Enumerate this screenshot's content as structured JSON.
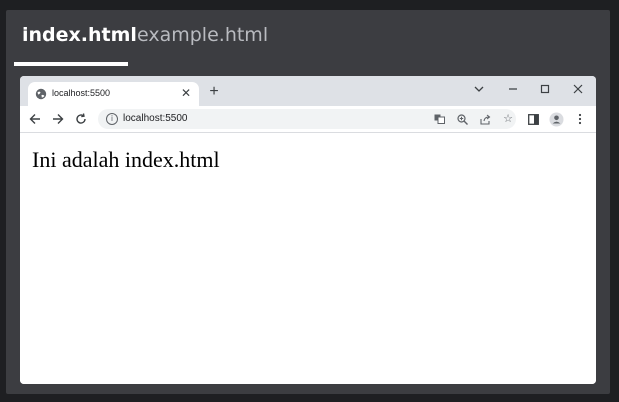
{
  "editor_tabs": [
    {
      "label": "index.html",
      "active": true
    },
    {
      "label": "example.html",
      "active": false
    }
  ],
  "browser": {
    "tab": {
      "title": "localhost:5500",
      "favicon": "globe-icon"
    },
    "address": "localhost:5500",
    "window_controls": [
      "tab-search-icon",
      "minimize-icon",
      "maximize-icon",
      "close-icon"
    ],
    "toolbar_icons": [
      "back-arrow-icon",
      "forward-arrow-icon",
      "reload-icon",
      "translate-icon",
      "zoom-icon",
      "share-icon",
      "bookmark-star-icon",
      "side-panel-icon",
      "profile-icon",
      "menu-icon"
    ]
  },
  "page": {
    "text": "Ini adalah index.html"
  },
  "colors": {
    "background": "#1e1f22",
    "panel": "#3c3d41",
    "active_tab_text": "#ffffff",
    "inactive_tab_text": "#b9bbc0",
    "browser_titlebar": "#dee1e6",
    "omnibox": "#f1f3f4"
  }
}
